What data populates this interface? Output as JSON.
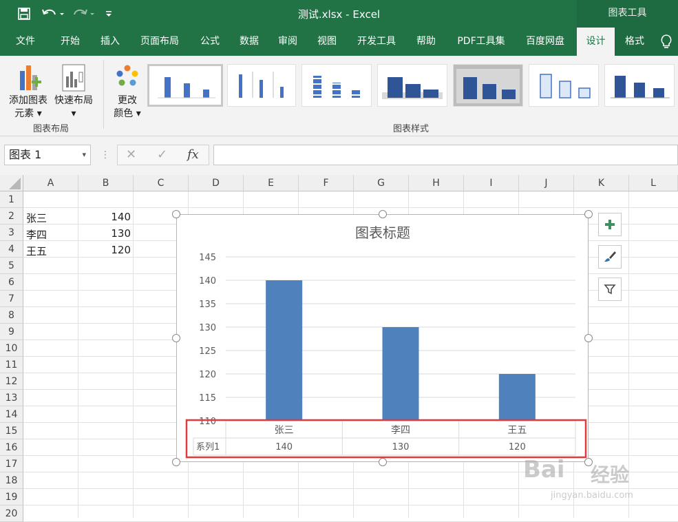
{
  "window": {
    "title": "测试.xlsx  -  Excel",
    "context_tab_group": "图表工具"
  },
  "quick_access": {
    "save_icon": "save-icon",
    "undo_icon": "undo-icon",
    "redo_icon": "redo-icon",
    "customize_icon": "customize-icon"
  },
  "tabs": [
    "文件",
    "开始",
    "插入",
    "页面布局",
    "公式",
    "数据",
    "审阅",
    "视图",
    "开发工具",
    "帮助",
    "PDF工具集",
    "百度网盘",
    "设计",
    "格式"
  ],
  "active_tab": "设计",
  "tell_me_icon": "lightbulb-icon",
  "ribbon": {
    "add_element": {
      "line1": "添加图表",
      "line2": "元素"
    },
    "quick_layout": {
      "line1": "快速布局"
    },
    "group_chart_layout": "图表布局",
    "change_color": {
      "line1": "更改",
      "line2": "颜色"
    },
    "group_chart_styles": "图表样式"
  },
  "formula_bar": {
    "name_box": "图表 1",
    "cancel": "✕",
    "enter": "✓",
    "fx": "fx",
    "formula": ""
  },
  "columns": [
    "A",
    "B",
    "C",
    "D",
    "E",
    "F",
    "G",
    "H",
    "I",
    "J",
    "K",
    "L"
  ],
  "rows": [
    "1",
    "2",
    "3",
    "4",
    "5",
    "6",
    "7",
    "8",
    "9",
    "10",
    "11",
    "12",
    "13",
    "14",
    "15",
    "16",
    "17",
    "18",
    "19",
    "20"
  ],
  "cells": {
    "A2": "张三",
    "B2": "140",
    "A3": "李四",
    "B3": "130",
    "A4": "王五",
    "B4": "120"
  },
  "chart_data": {
    "type": "bar",
    "title": "图表标题",
    "categories": [
      "张三",
      "李四",
      "王五"
    ],
    "series": [
      {
        "name": "系列1",
        "values": [
          140,
          130,
          120
        ]
      }
    ],
    "ylim": [
      110,
      145
    ],
    "yticks": [
      "145",
      "140",
      "135",
      "130",
      "125",
      "120",
      "115",
      "110"
    ],
    "bar_color": "#4f81bd",
    "grid": true,
    "data_table": {
      "series_label": "系列1",
      "values": [
        "140",
        "130",
        "120"
      ]
    },
    "highlight_color": "#e03a3e"
  },
  "chart_side_buttons": [
    "plus-icon",
    "brush-icon",
    "filter-icon"
  ],
  "colors": {
    "excel_green": "#217346",
    "ribbon_bg": "#f3f3f3"
  },
  "watermark": {
    "text1": "Bai",
    "text2": "经验",
    "text3": "jingyan.baidu.com"
  }
}
